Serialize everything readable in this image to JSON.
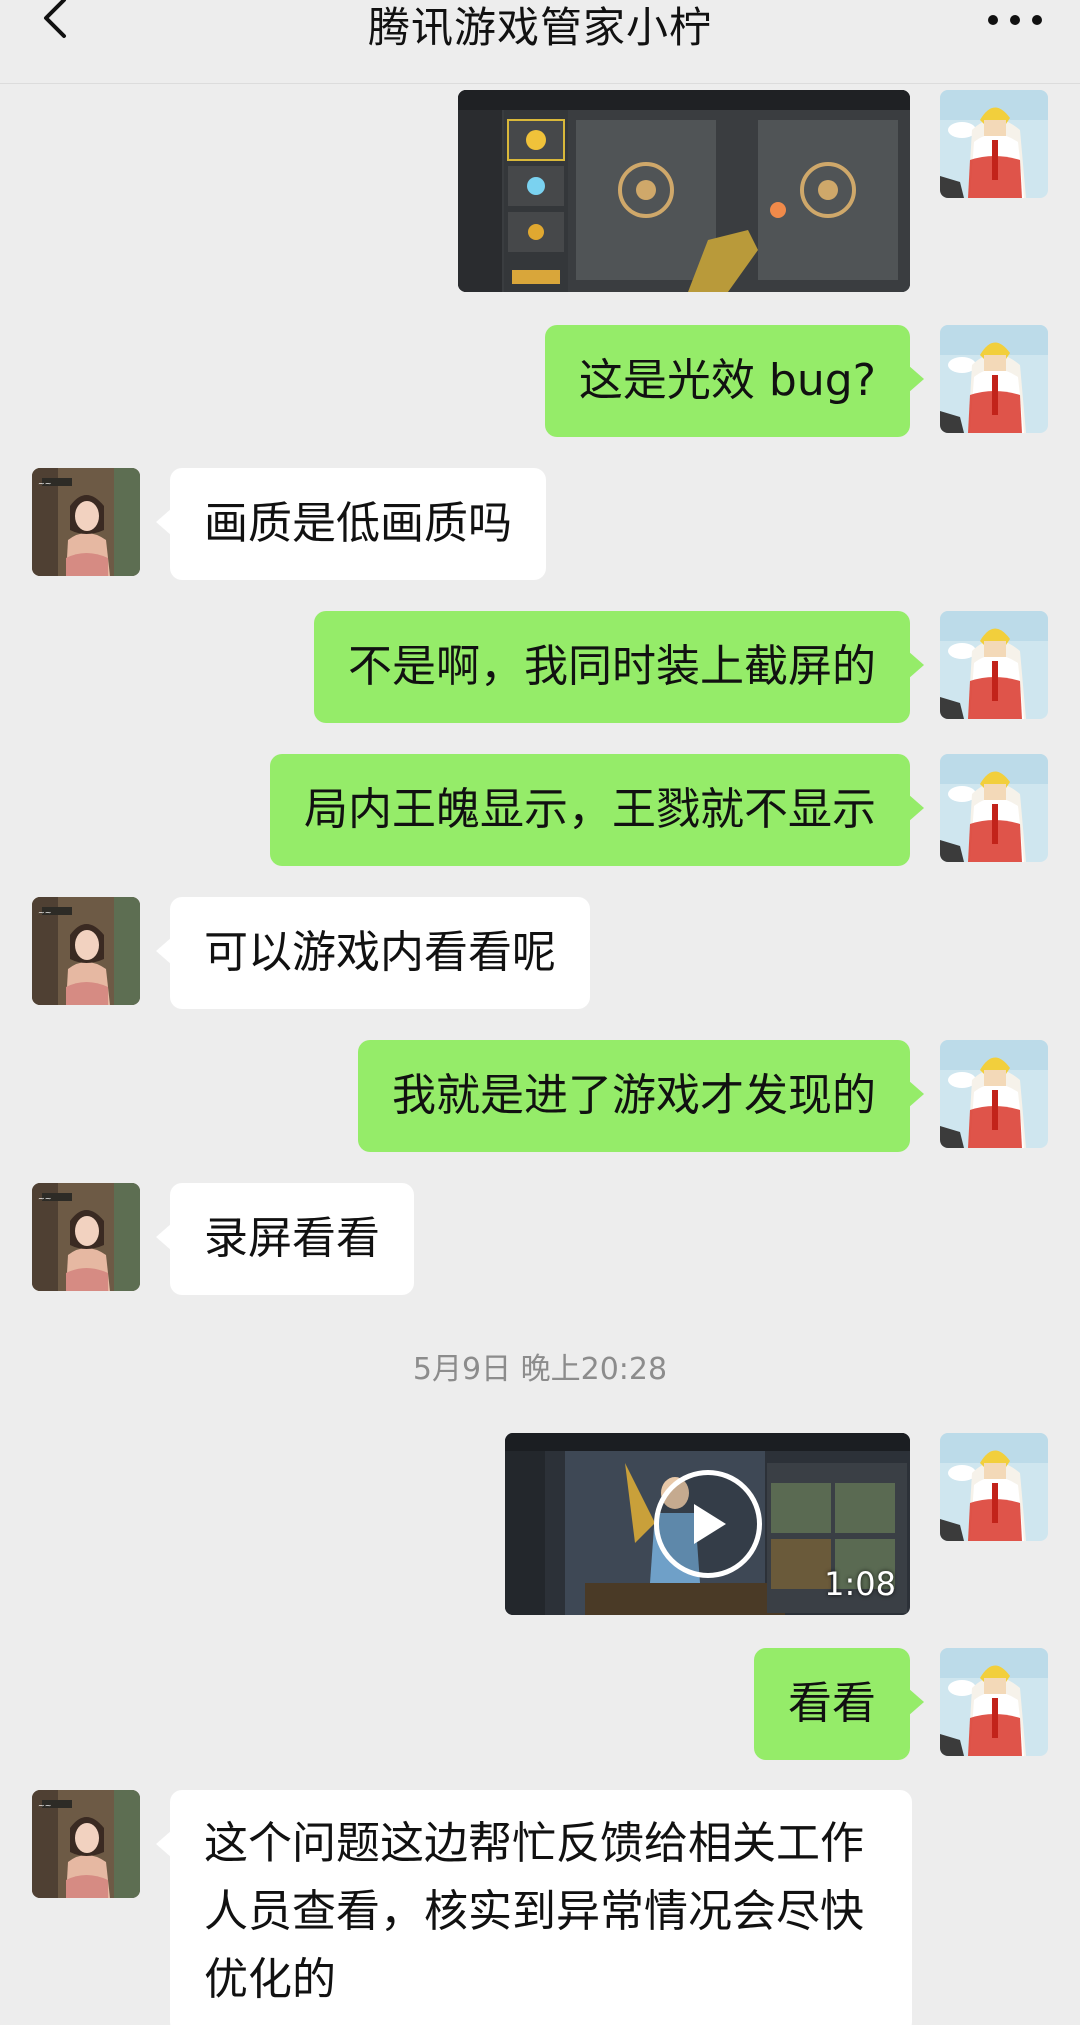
{
  "header": {
    "title": "腾讯游戏管家小柠",
    "back_icon": "chevron-left-icon",
    "more_icon": "ellipsis-icon"
  },
  "messages": [
    {
      "side": "right",
      "type": "image"
    },
    {
      "side": "right",
      "type": "text",
      "text": "这是光效 bug?"
    },
    {
      "side": "left",
      "type": "text",
      "text": "画质是低画质吗"
    },
    {
      "side": "right",
      "type": "text",
      "text": "不是啊，我同时装上截屏的"
    },
    {
      "side": "right",
      "type": "text",
      "text": "局内王魄显示，王戮就不显示"
    },
    {
      "side": "left",
      "type": "text",
      "text": "可以游戏内看看呢"
    },
    {
      "side": "right",
      "type": "text",
      "text": "我就是进了游戏才发现的"
    },
    {
      "side": "left",
      "type": "text",
      "text": "录屏看看"
    },
    {
      "type": "timestamp",
      "text": "5月9日 晚上20:28"
    },
    {
      "side": "right",
      "type": "video",
      "duration": "1:08"
    },
    {
      "side": "right",
      "type": "text",
      "text": "看看"
    },
    {
      "side": "left",
      "type": "text",
      "text": "这个问题这边帮忙反馈给相关工作人员查看，核实到异常情况会尽快优化的"
    }
  ],
  "colors": {
    "background": "#ededed",
    "sent_bubble": "#95ec69",
    "received_bubble": "#ffffff",
    "timestamp_text": "#8c8c8c"
  }
}
